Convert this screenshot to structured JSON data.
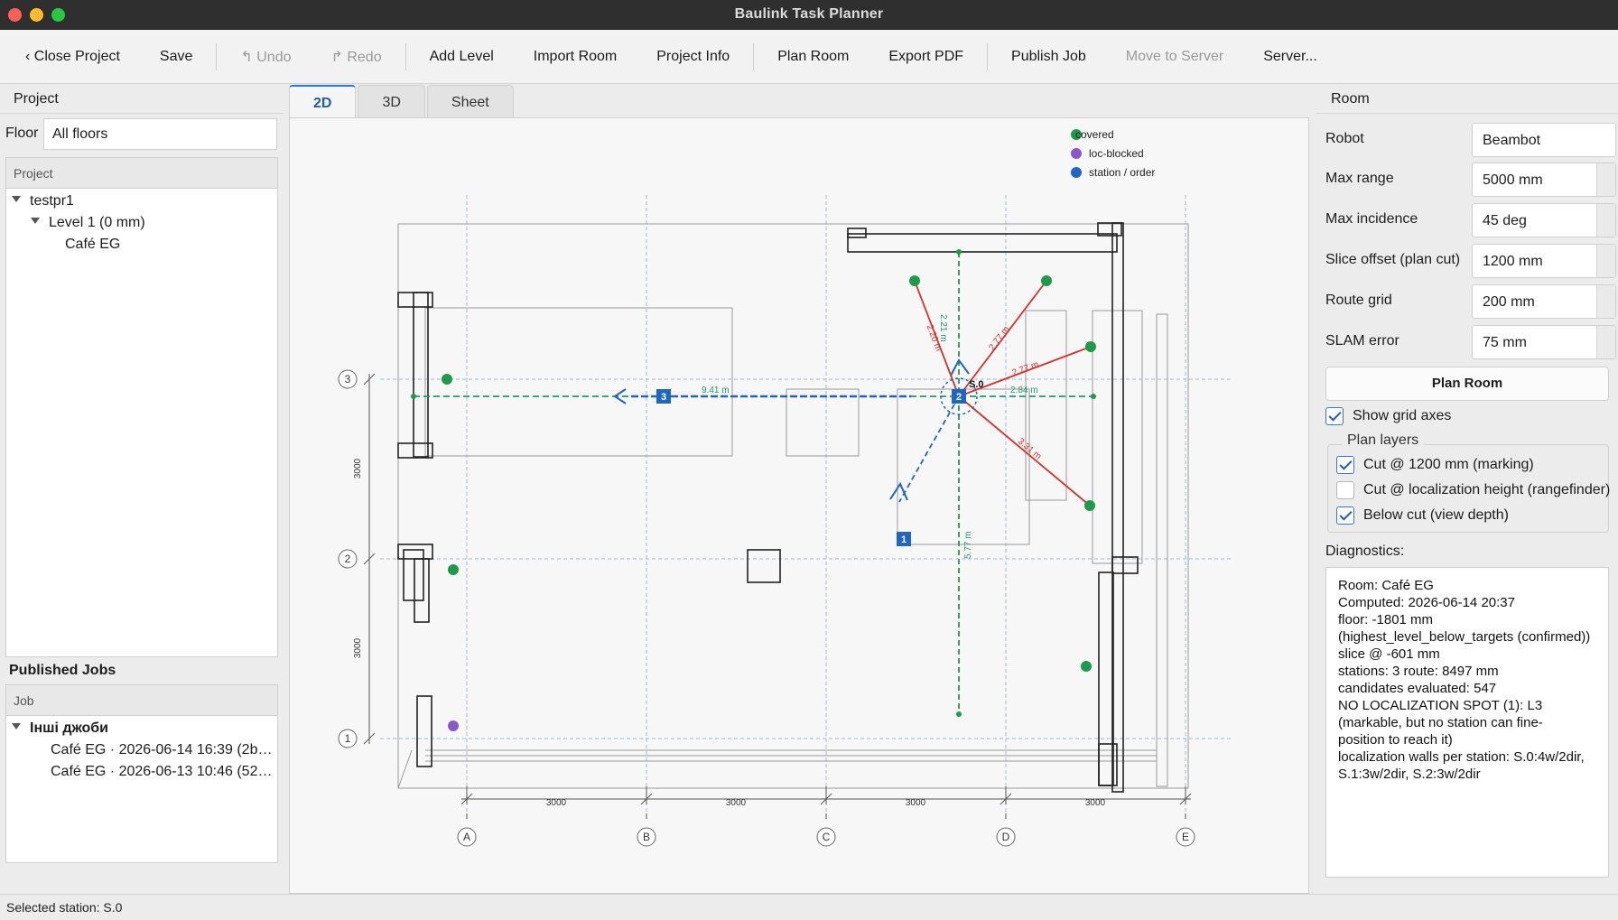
{
  "window": {
    "title": "Baulink Task Planner"
  },
  "toolbar": {
    "close_project": "‹ Close Project",
    "save": "Save",
    "undo": "↰ Undo",
    "redo": "↱ Redo",
    "add_level": "Add Level",
    "import_room": "Import Room",
    "project_info": "Project Info",
    "plan_room": "Plan Room",
    "export_pdf": "Export PDF",
    "publish_job": "Publish Job",
    "move_to_server": "Move to Server",
    "server": "Server..."
  },
  "left": {
    "header": "Project",
    "floor_label": "Floor",
    "floor_value": "All floors",
    "tree_header": "Project",
    "tree": {
      "project": "testpr1",
      "level": "Level 1  (0 mm)",
      "room": "Café EG"
    },
    "jobs_title": "Published Jobs",
    "jobs_header": "Job",
    "jobs_group": "Інші джоби",
    "jobs": [
      "Café EG · 2026-06-14 16:39  (2b…",
      "Café EG · 2026-06-13 10:46  (52…"
    ]
  },
  "tabs": [
    "2D",
    "3D",
    "Sheet"
  ],
  "plan": {
    "legend": [
      {
        "label": "covered",
        "color": "#1e9b48"
      },
      {
        "label": "loc-blocked",
        "color": "#8d57c9"
      },
      {
        "label": "station / order",
        "color": "#1f66c4"
      }
    ],
    "grid_cols": [
      "A",
      "B",
      "C",
      "D",
      "E"
    ],
    "grid_rows": [
      "3",
      "2",
      "1"
    ],
    "col_dims": [
      "3000",
      "3000",
      "3000",
      "3000"
    ],
    "row_dims": [
      "3000",
      "3000"
    ],
    "stations": [
      "1",
      "2",
      "3"
    ],
    "selected_tag": "S.0",
    "measure_labels": {
      "route_3": "9.41 m",
      "right": "2.84 m",
      "vertical_down": "5.77 m",
      "vertical_up": "2.21 m",
      "ray_up_left": "2.20 m",
      "ray_up_right": "2.77 m",
      "ray_right": "2.77 m",
      "ray_down_right": "3.31 m"
    }
  },
  "right": {
    "header": "Room",
    "props": [
      {
        "label": "Robot",
        "value": "Beambot"
      },
      {
        "label": "Max range",
        "value": "5000 mm"
      },
      {
        "label": "Max incidence",
        "value": "45 deg"
      },
      {
        "label": "Slice offset (plan cut)",
        "value": "1200 mm"
      },
      {
        "label": "Route grid",
        "value": "200 mm"
      },
      {
        "label": "SLAM error",
        "value": "75 mm"
      }
    ],
    "plan_button": "Plan Room",
    "show_grid_axes": "Show grid axes",
    "plan_layers_title": "Plan layers",
    "layers": [
      {
        "label": "Cut @ 1200 mm (marking)",
        "checked": true
      },
      {
        "label": "Cut @ localization height (rangefinder)",
        "checked": false
      },
      {
        "label": "Below cut (view depth)",
        "checked": true
      }
    ],
    "diagnostics_label": "Diagnostics:",
    "diagnostics": [
      "Room: Café EG",
      "Computed: 2026-06-14 20:37",
      "floor: -1801 mm",
      "(highest_level_below_targets (confirmed))",
      "slice @ -601 mm",
      "stations: 3   route: 8497 mm",
      "candidates evaluated: 547",
      "NO LOCALIZATION SPOT (1): L3",
      "(markable, but no station can fine-",
      "position to reach it)",
      "localization walls per station: S.0:4w/2dir,",
      "S.1:3w/2dir, S.2:3w/2dir"
    ]
  },
  "status": "Selected station: S.0"
}
